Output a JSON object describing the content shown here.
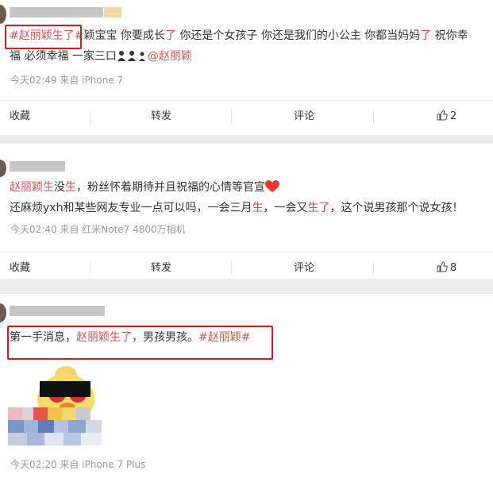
{
  "posts": [
    {
      "hashtag": "#赵丽颖生了#",
      "line1_rest": "颖宝宝 你要成长",
      "le1": "了",
      "line1_mid": " 你还是个女孩子 你还是我们的小公主 你都当妈妈",
      "le2": "了",
      "line1_end": " 祝你幸",
      "line2_text": "福 必须幸福 一家三口",
      "mention": "@赵丽颖",
      "meta": "今天02:49 来自 iPhone 7",
      "actions": {
        "collect": "收藏",
        "repost": "转发",
        "comment": "评论",
        "likes": "2"
      }
    },
    {
      "name_link": "赵丽颖生",
      "line1_a": "没",
      "line1_b": "生",
      "line1_c": "，粉丝怀着期待并且祝福的心情等官宣",
      "line2_a": "还麻烦yxh和某些网友专业一点可以吗，一会三月",
      "line2_sheng": "生",
      "line2_b": "，一会又",
      "line2_shengle": "生了",
      "line2_c": "，这个说男孩那个说女孩！",
      "meta": "今天02:40 来自 红米Note7 4800万相机",
      "actions": {
        "collect": "收藏",
        "repost": "转发",
        "comment": "评论",
        "likes": "8"
      }
    },
    {
      "text_a": "第一手消息，",
      "text_link": "赵丽颖生了",
      "text_b": "，男孩男孩。",
      "hashtag": "#赵丽颖#",
      "meta": "今天02:20 来自 iPhone 7 Plus"
    }
  ],
  "colors": {
    "link": "#e2433b",
    "highlight_box": "#e0161b",
    "meta": "#999999"
  }
}
